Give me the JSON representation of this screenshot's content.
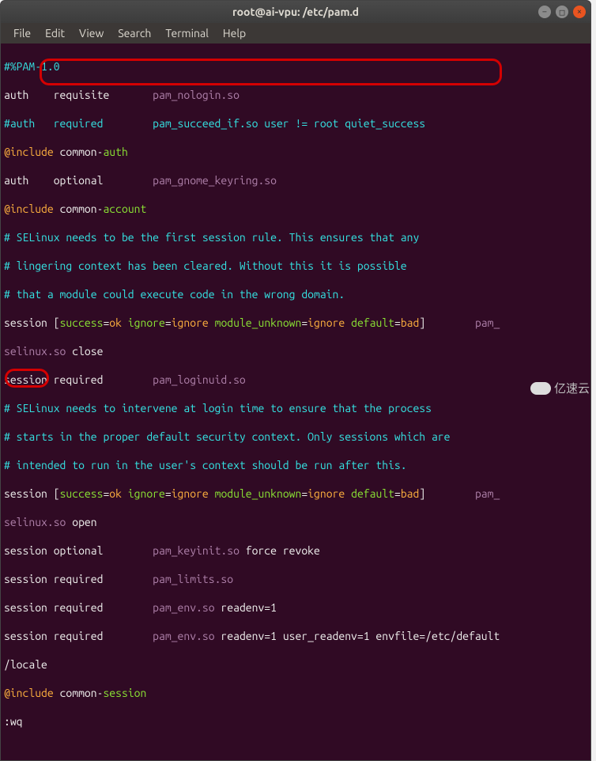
{
  "window": {
    "title": "root@ai-vpu: /etc/pam.d"
  },
  "menu": {
    "file": "File",
    "edit": "Edit",
    "view": "View",
    "search": "Search",
    "terminal": "Terminal",
    "help": "Help"
  },
  "lines": {
    "l0": "#%PAM-1.0",
    "l1_a": "auth    requisite       ",
    "l1_b": "pam_nologin.so",
    "l2_a": "#auth   required        pam_succeed_if.so user != root quiet_success",
    "l3_a": "@include",
    "l3_b": " common-",
    "l3_c": "auth",
    "l4_a": "auth    optional        ",
    "l4_b": "pam_gnome_keyring.so",
    "l5_a": "@include",
    "l5_b": " common-",
    "l5_c": "account",
    "l6": "# SELinux needs to be the first session rule. This ensures that any",
    "l7": "# lingering context has been cleared. Without this it is possible",
    "l8": "# that a module could execute code in the wrong domain.",
    "l9_a": "session [",
    "l9_b": "success",
    "l9_eq": "=",
    "l9_c": "ok",
    "l9_d": " ignore",
    "l9_e": "ignore",
    "l9_f": " module_unknown",
    "l9_g": "ignore",
    "l9_h": " default",
    "l9_i": "bad",
    "l9_j": "]        ",
    "l9_k": "pam_",
    "l10_a": "selinux.so",
    "l10_b": " close",
    "l11_a": "session required        ",
    "l11_b": "pam_loginuid.so",
    "l12": "# SELinux needs to intervene at login time to ensure that the process",
    "l13": "# starts in the proper default security context. Only sessions which are",
    "l14": "# intended to run in the user's context should be run after this.",
    "l15_k": "pam_",
    "l16_a": "selinux.so",
    "l16_b": " open",
    "l17_a": "session optional        ",
    "l17_b": "pam_keyinit.so",
    "l17_c": " force revoke",
    "l18_a": "session required        ",
    "l18_b": "pam_limits.so",
    "l19_a": "session required        ",
    "l19_b": "pam_env.so",
    "l19_c": " readenv=1",
    "l20_a": "session required        ",
    "l20_b": "pam_env.so",
    "l20_c": " readenv=1 user_readenv=1 envfile=/etc/default",
    "l21": "/locale",
    "l22_a": "@include",
    "l22_b": " common-",
    "l22_c": "session",
    "l23": ":wq"
  },
  "watermark": "亿速云"
}
